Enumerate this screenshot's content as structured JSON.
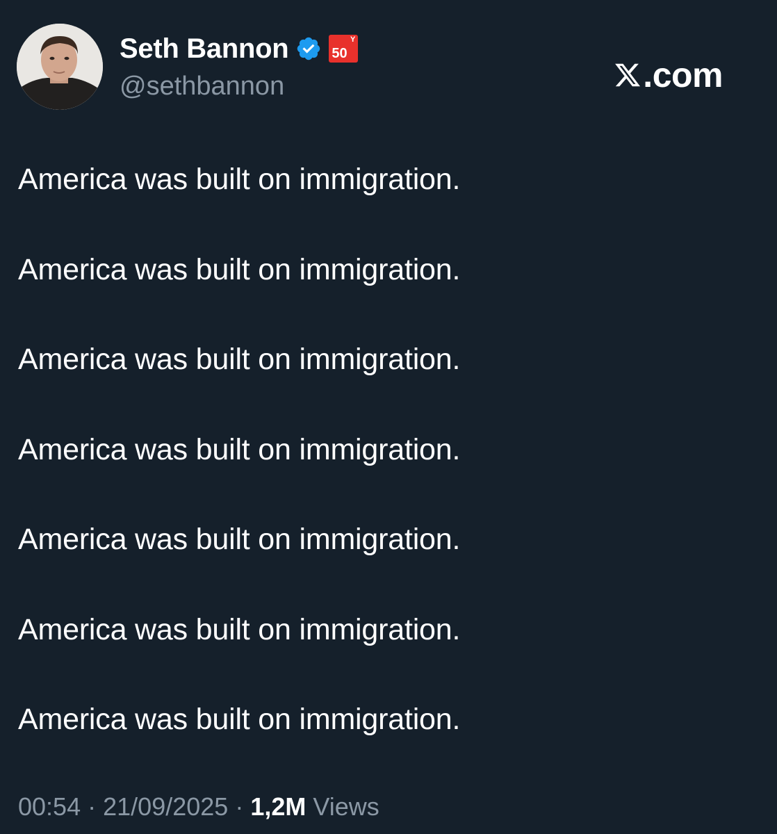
{
  "author": {
    "display_name": "Seth Bannon",
    "handle": "@sethbannon",
    "verified_icon": "verified-badge-icon",
    "badge": {
      "number": "50",
      "superscript": "Y",
      "color": "#e8312c"
    }
  },
  "brand": {
    "text": ".com",
    "icon": "x-logo-icon"
  },
  "tweet": {
    "lines": [
      "America was built on immigration.",
      "America was built on immigration.",
      "America was built on immigration.",
      "America was built on immigration.",
      "America was built on immigration.",
      "America was built on immigration.",
      "America was built on immigration."
    ]
  },
  "meta": {
    "time": "00:54",
    "separator": "·",
    "date": "21/09/2025",
    "views_count": "1,2M",
    "views_label": "Views"
  },
  "colors": {
    "background": "#15202b",
    "text": "#ffffff",
    "secondary_text": "#8b98a5",
    "verified_blue": "#1d9bf0"
  }
}
